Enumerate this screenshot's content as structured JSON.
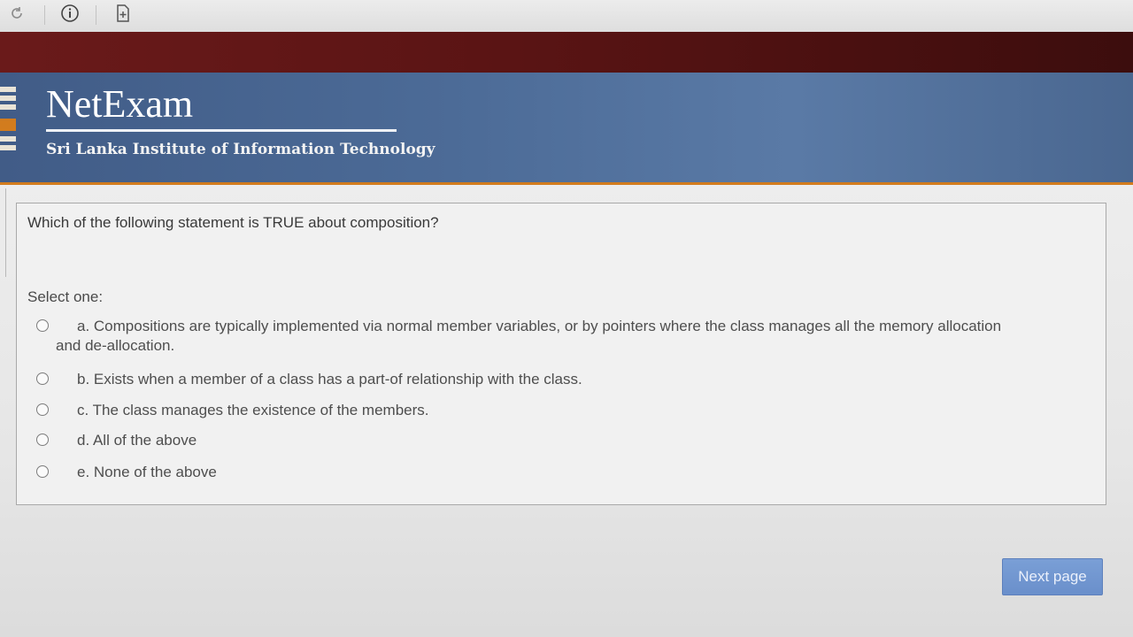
{
  "toolbar": {
    "icons": [
      "refresh-icon",
      "info-icon",
      "page-icon"
    ]
  },
  "header": {
    "brand": "NetExam",
    "institute": "Sri Lanka Institute of Information Technology"
  },
  "question": {
    "text": "Which of the following statement is TRUE about composition?",
    "select_label": "Select one:",
    "options": [
      {
        "label": "a. Compositions are typically implemented via normal member variables, or by pointers where the class manages all the memory allocation and de-allocation."
      },
      {
        "label": "b. Exists when a member of a class has a part-of relationship with the class."
      },
      {
        "label": "c. The class manages the existence of the members."
      },
      {
        "label": "d. All of the above"
      },
      {
        "label": "e. None of the above"
      }
    ]
  },
  "navigation": {
    "next_label": "Next page"
  },
  "colors": {
    "header_blue": "#4c6b97",
    "red_band": "#5a1414",
    "accent_orange": "#d27c1e",
    "button_blue": "#6a8fcb"
  }
}
